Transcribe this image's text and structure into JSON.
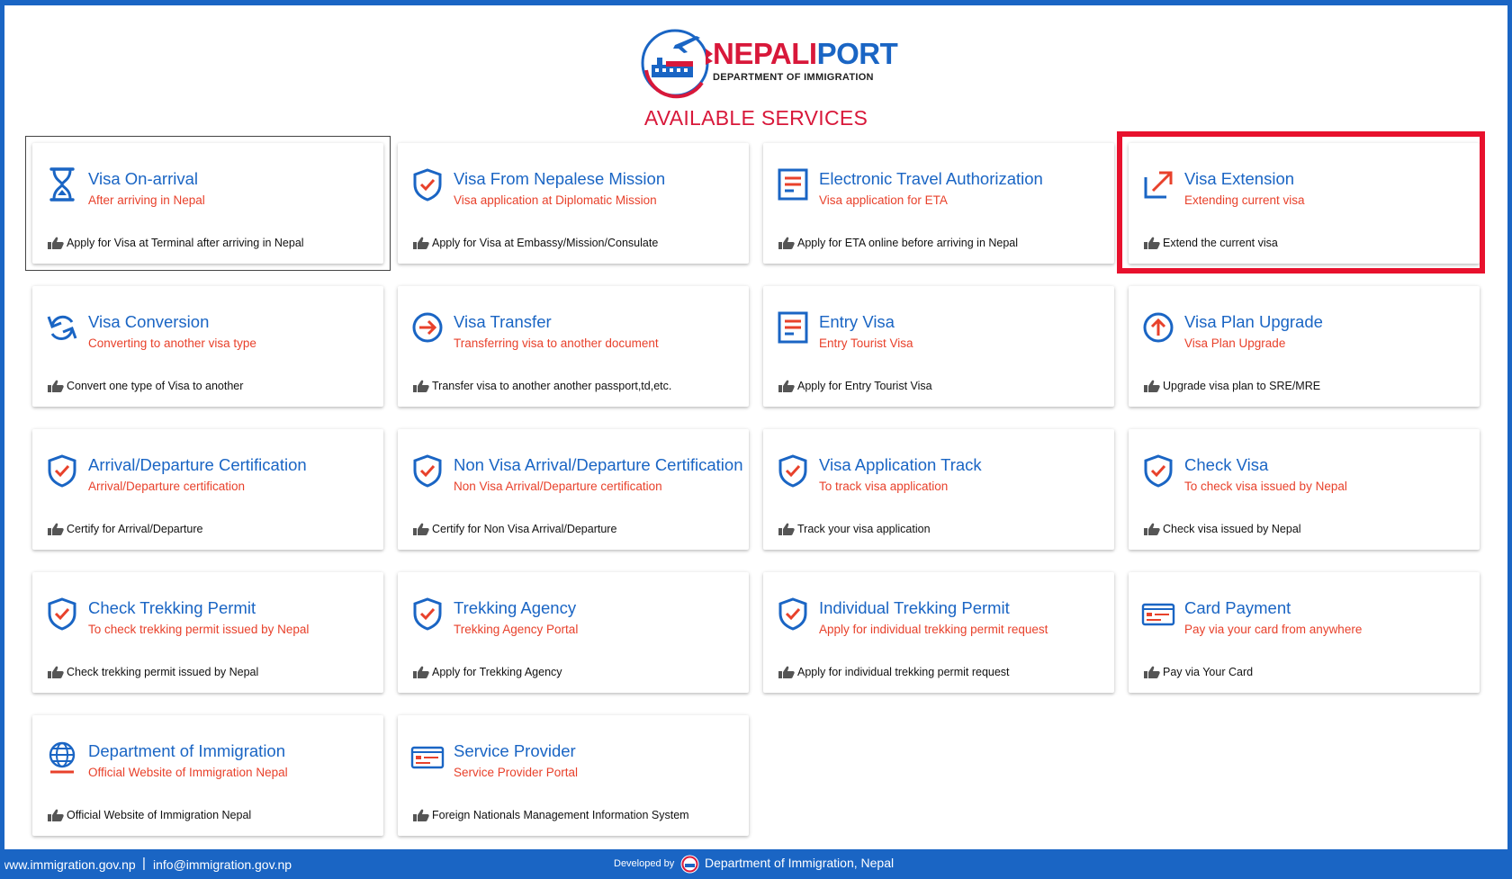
{
  "header": {
    "logo_word_1": "NEPALI",
    "logo_word_2": "PORT",
    "logo_subtitle": "DEPARTMENT OF IMMIGRATION",
    "page_title": "AVAILABLE SERVICES"
  },
  "colors": {
    "brand_blue": "#1a65c4",
    "brand_red": "#d8183a",
    "subtitle_orange": "#e8412b",
    "highlight_red": "#e8112d"
  },
  "services": [
    {
      "title": "Visa On-arrival",
      "subtitle": "After arriving in Nepal",
      "description": "Apply for Visa at Terminal after arriving in Nepal",
      "icon": "hourglass-icon"
    },
    {
      "title": "Visa From Nepalese Mission",
      "subtitle": "Visa application at Diplomatic Mission",
      "description": "Apply for Visa at Embassy/Mission/Consulate",
      "icon": "shield-check-icon"
    },
    {
      "title": "Electronic Travel Authorization",
      "subtitle": "Visa application for ETA",
      "description": "Apply for ETA online before arriving in Nepal",
      "icon": "document-icon"
    },
    {
      "title": "Visa Extension",
      "subtitle": "Extending current visa",
      "description": "Extend the current visa",
      "icon": "extend-arrow-icon"
    },
    {
      "title": "Visa Conversion",
      "subtitle": "Converting to another visa type",
      "description": "Convert one type of Visa to another",
      "icon": "refresh-icon"
    },
    {
      "title": "Visa Transfer",
      "subtitle": "Transferring visa to another document",
      "description": "Transfer visa to another another passport,td,etc.",
      "icon": "arrow-circle-icon"
    },
    {
      "title": "Entry Visa",
      "subtitle": "Entry Tourist Visa",
      "description": "Apply for Entry Tourist Visa",
      "icon": "document-icon"
    },
    {
      "title": "Visa Plan Upgrade",
      "subtitle": "Visa Plan Upgrade",
      "description": "Upgrade visa plan to SRE/MRE",
      "icon": "upgrade-circle-icon"
    },
    {
      "title": "Arrival/Departure Certification",
      "subtitle": "Arrival/Departure certification",
      "description": "Certify for Arrival/Departure",
      "icon": "shield-check-icon"
    },
    {
      "title": "Non Visa Arrival/Departure Certification",
      "subtitle": "Non Visa Arrival/Departure certification",
      "description": "Certify for Non Visa Arrival/Departure",
      "icon": "shield-check-icon"
    },
    {
      "title": "Visa Application Track",
      "subtitle": "To track visa application",
      "description": "Track your visa application",
      "icon": "shield-check-icon"
    },
    {
      "title": "Check Visa",
      "subtitle": "To check visa issued by Nepal",
      "description": "Check visa issued by Nepal",
      "icon": "shield-check-icon"
    },
    {
      "title": "Check Trekking Permit",
      "subtitle": "To check trekking permit issued by Nepal",
      "description": "Check trekking permit issued by Nepal",
      "icon": "shield-check-icon"
    },
    {
      "title": "Trekking Agency",
      "subtitle": "Trekking Agency Portal",
      "description": "Apply for Trekking Agency",
      "icon": "shield-check-icon"
    },
    {
      "title": "Individual Trekking Permit",
      "subtitle": "Apply for individual trekking permit request",
      "description": "Apply for individual trekking permit request",
      "icon": "shield-check-icon"
    },
    {
      "title": "Card Payment",
      "subtitle": "Pay via your card from anywhere",
      "description": "Pay via Your Card",
      "icon": "card-icon"
    },
    {
      "title": "Department of Immigration",
      "subtitle": "Official Website of Immigration Nepal",
      "description": "Official Website of Immigration Nepal",
      "icon": "globe-icon"
    },
    {
      "title": "Service Provider",
      "subtitle": "Service Provider Portal",
      "description": "Foreign Nationals Management Information System",
      "icon": "card-icon"
    }
  ],
  "footer": {
    "website": "www.immigration.gov.np",
    "separator": "|",
    "email": "info@immigration.gov.np",
    "developed_by": "Developed by",
    "developer": "Department of Immigration, Nepal"
  }
}
